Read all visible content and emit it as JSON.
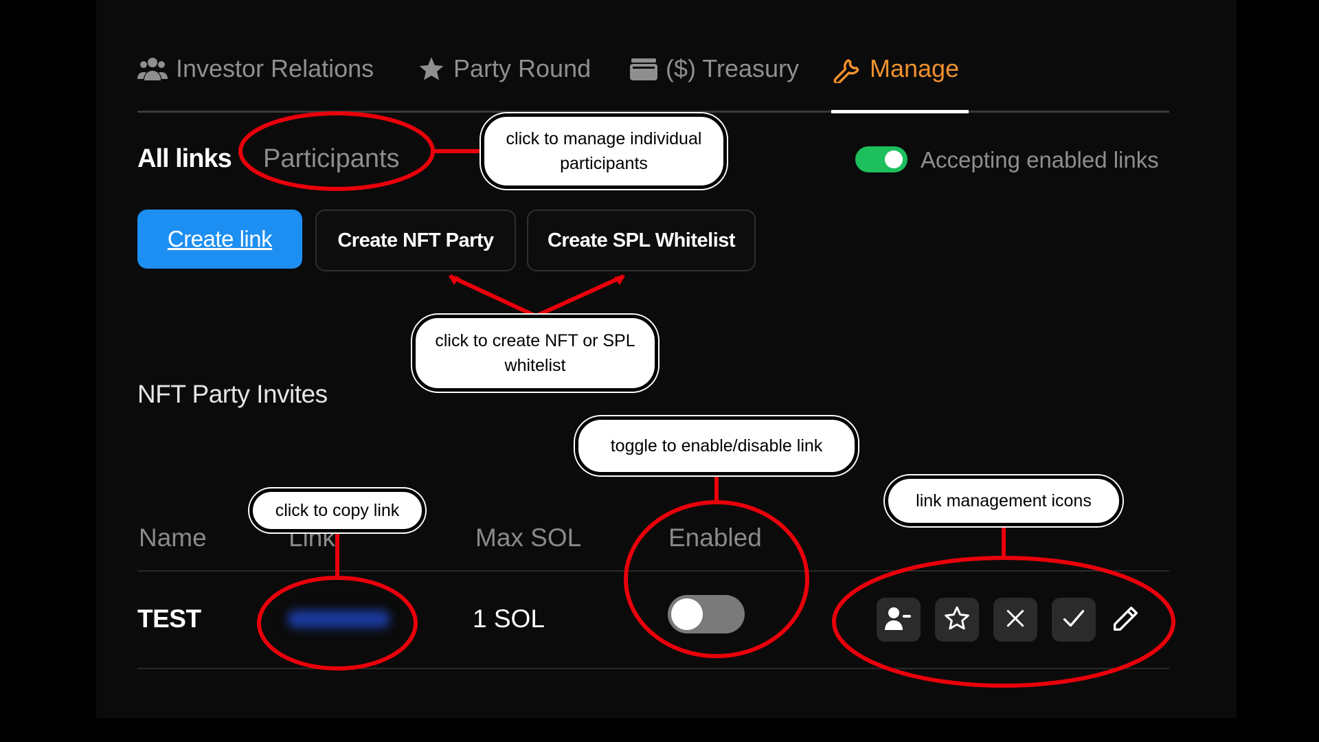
{
  "tabs": [
    {
      "label": "Investor Relations",
      "icon": "users-icon"
    },
    {
      "label": "Party Round",
      "icon": "star-icon"
    },
    {
      "label": "($) Treasury",
      "icon": "wallet-icon"
    },
    {
      "label": "Manage",
      "icon": "wrench-icon",
      "active": true
    }
  ],
  "subtabs": {
    "all_links": "All links",
    "participants": "Participants"
  },
  "accepting": {
    "label": "Accepting enabled links",
    "enabled": true
  },
  "buttons": {
    "create_link": "Create link",
    "create_nft_party": "Create NFT Party",
    "create_spl_whitelist": "Create SPL Whitelist"
  },
  "section_title": "NFT Party Invites",
  "table": {
    "headers": [
      "Name",
      "Link",
      "Max SOL",
      "Enabled"
    ],
    "rows": [
      {
        "name": "TEST",
        "max_sol": "1 SOL",
        "enabled": false
      }
    ]
  },
  "row_icons": [
    "user-minus-icon",
    "star-icon",
    "close-icon",
    "check-icon",
    "pencil-icon"
  ],
  "annotations": {
    "participants": "click to manage individual participants",
    "create": "click to create NFT or SPL whitelist",
    "toggle": "toggle to enable/disable link",
    "copy": "click to copy link",
    "icons": "link management icons"
  },
  "colors": {
    "accent": "#f0912e",
    "primary": "#1d8ff2",
    "toggle_on": "#1dbf5c",
    "annotation": "#e8000b"
  }
}
